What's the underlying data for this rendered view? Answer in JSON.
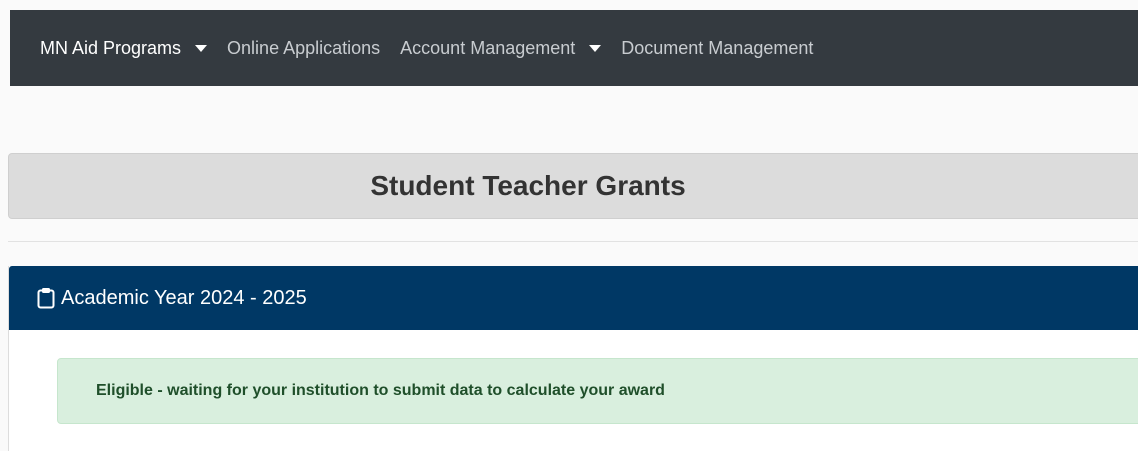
{
  "nav": {
    "items": [
      {
        "label": "MN Aid Programs",
        "has_dropdown": true,
        "active": true
      },
      {
        "label": "Online Applications",
        "has_dropdown": false,
        "active": false
      },
      {
        "label": "Account Management",
        "has_dropdown": true,
        "active": false
      },
      {
        "label": "Document Management",
        "has_dropdown": false,
        "active": false
      }
    ]
  },
  "page": {
    "title": "Student Teacher Grants"
  },
  "card": {
    "icon": "clipboard-icon",
    "header": "Academic Year 2024 - 2025",
    "status_message": "Eligible - waiting for your institution to submit data to calculate your award"
  },
  "colors": {
    "navbar_bg": "#343a40",
    "card_header_bg": "#003865",
    "alert_bg": "#d9efde",
    "alert_text": "#1f4f2a",
    "title_bar_bg": "#dcdcdc"
  }
}
